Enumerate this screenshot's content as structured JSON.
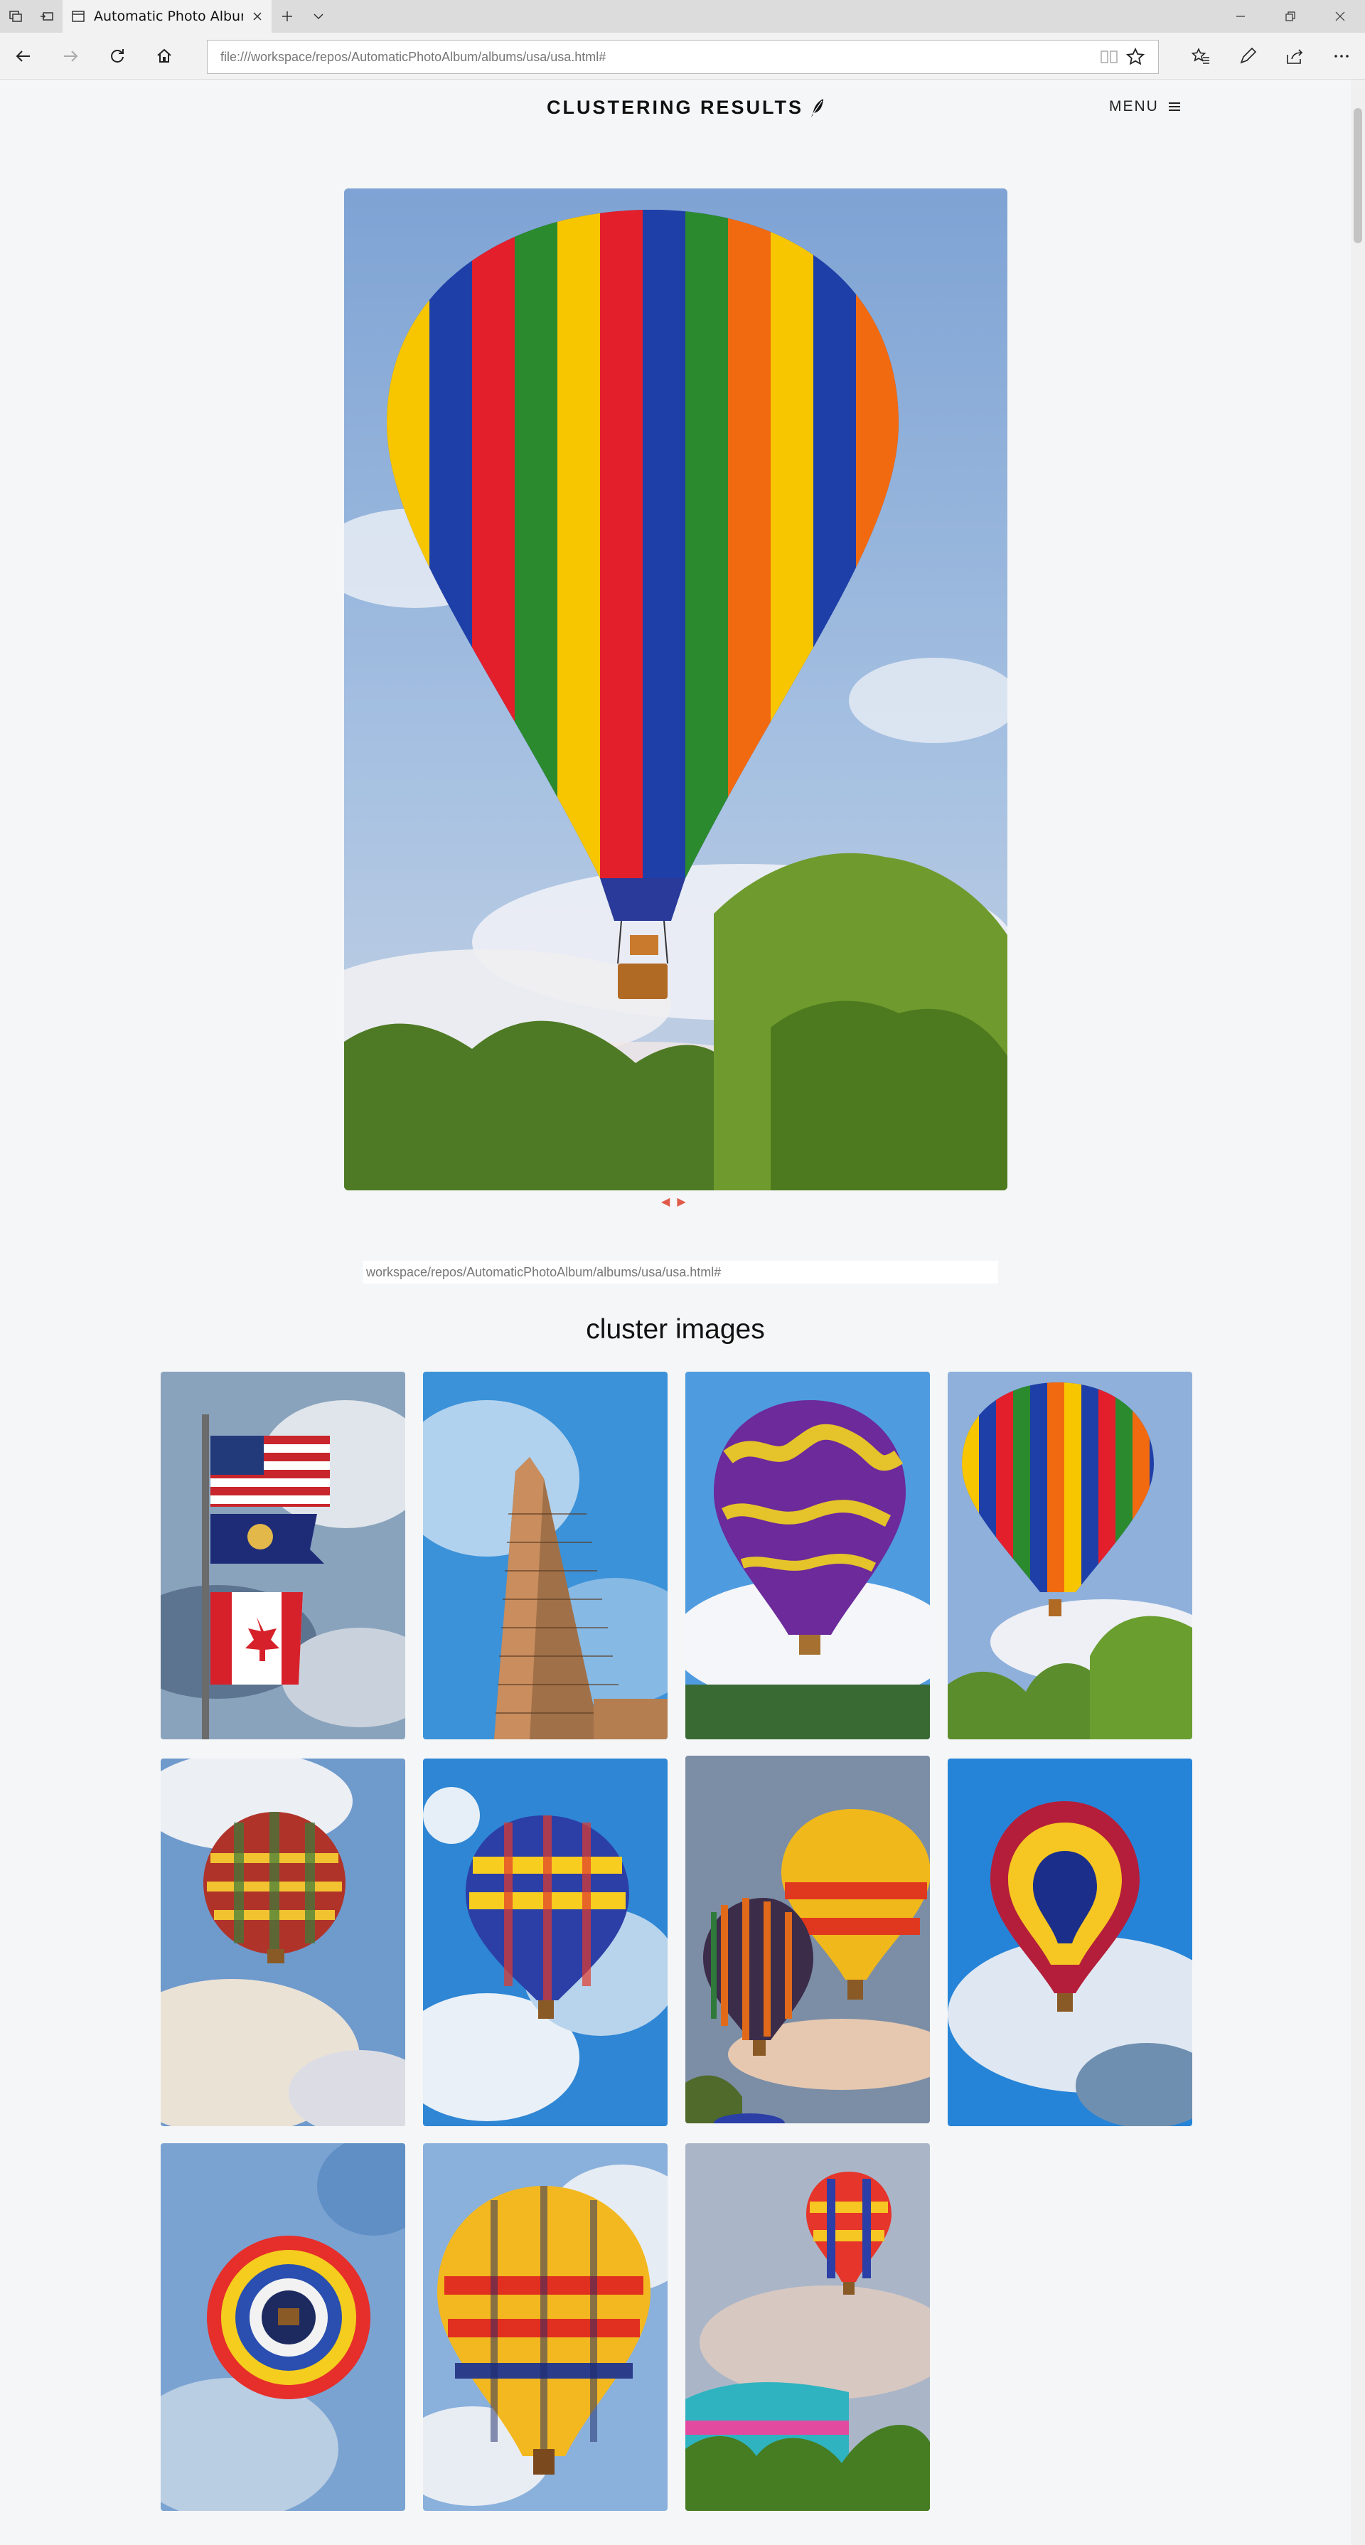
{
  "browser": {
    "tab_title": "Automatic Photo Albun",
    "address": "file:///workspace/repos/AutomaticPhotoAlbum/albums/usa/usa.html#"
  },
  "site": {
    "title": "CLUSTERING RESULTS",
    "menu_label": "MENU"
  },
  "gallery": {
    "url_field_value": "workspace/repos/AutomaticPhotoAlbum/albums/usa/usa.html#",
    "cluster_heading": "cluster images"
  },
  "images": [
    {
      "subject": "flags"
    },
    {
      "subject": "flatiron-building"
    },
    {
      "subject": "purple-swirl-balloon"
    },
    {
      "subject": "striped-balloon"
    },
    {
      "subject": "checkered-balloon"
    },
    {
      "subject": "yellow-blue-balloon"
    },
    {
      "subject": "two-balloons"
    },
    {
      "subject": "red-yellow-blue-balloon"
    },
    {
      "subject": "balloon-from-below"
    },
    {
      "subject": "yellow-checkered-balloon"
    },
    {
      "subject": "balloon-over-trees"
    }
  ]
}
